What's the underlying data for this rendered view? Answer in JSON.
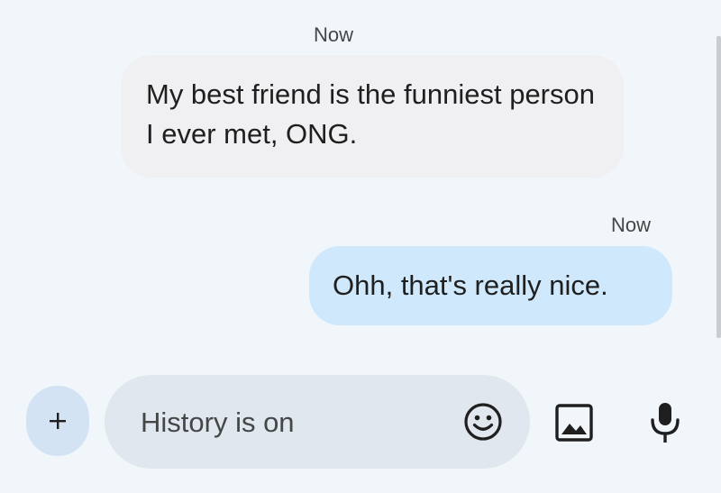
{
  "messages": [
    {
      "direction": "incoming",
      "timestamp": "Now",
      "text": "My best friend is the funniest person I ever met, ONG."
    },
    {
      "direction": "outgoing",
      "timestamp": "Now",
      "text": "Ohh, that's really nice."
    }
  ],
  "composer": {
    "placeholder": "History is on",
    "value": "",
    "add_icon": "plus-icon",
    "emoji_icon": "emoji-icon",
    "gallery_icon": "image-icon",
    "mic_icon": "mic-icon"
  },
  "colors": {
    "background": "#f1f6fb",
    "incoming_bubble": "#f0f0f2",
    "outgoing_bubble": "#cfe8fb",
    "compose_field": "#e1e7ee",
    "add_button": "#d3e3f4",
    "icon": "#1f1f1f"
  }
}
